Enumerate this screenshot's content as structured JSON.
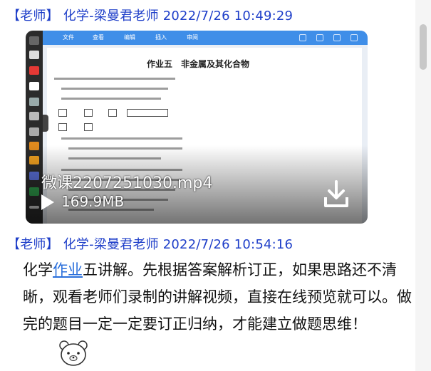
{
  "messages": [
    {
      "header": "【老师】 化学-梁曼君老师 2022/7/26 10:49:29",
      "attachment": {
        "file_name": "微课2207251030.mp4",
        "file_size": "169.9MB",
        "preview": {
          "toolbar_items": [
            "文件",
            "查看",
            "编辑",
            "插入",
            "审阅"
          ],
          "page_title": "作业五　非金属及其化合物"
        }
      }
    },
    {
      "header": "【老师】 化学-梁曼君老师 2022/7/26 10:54:16",
      "text_before_link": "化学",
      "link_text": "作业",
      "text_after_link": "五讲解。先根据答案解析订正，如果思路还不清晰，观看老师们录制的讲解视频，直接在线预览就可以。做完的题目一定一定要订正归纳，才能建立做题思维！"
    }
  ],
  "colors": {
    "header_text": "#1f3fc9",
    "link": "#2a6fdb",
    "toolbar": "#3f8ee8"
  },
  "icons": [
    "play-icon",
    "download-icon",
    "bear-sticker-icon"
  ]
}
